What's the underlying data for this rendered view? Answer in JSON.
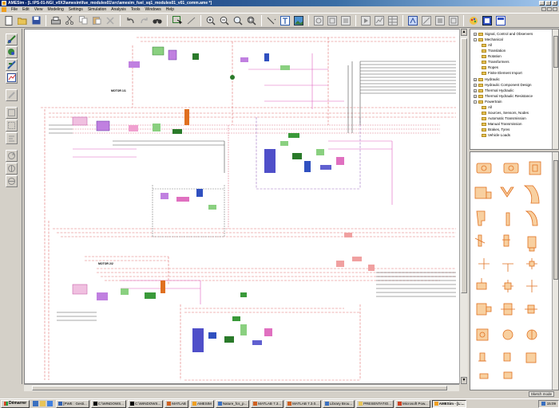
{
  "window": {
    "title": "AMESim - [L:\\PS-01-NGI_v0X3\\amesim\\fue_modules01\\src\\amesim_fuel_sq1_modules01_v01_comm.ame *]"
  },
  "menu": {
    "items": [
      "File",
      "Edit",
      "View",
      "Modeling",
      "Settings",
      "Simulation",
      "Analysis",
      "Tools",
      "Windows",
      "Help"
    ]
  },
  "toolbar": {
    "icons": [
      "new-icon",
      "open-icon",
      "save-icon",
      "print-icon",
      "cut-icon",
      "copy-icon",
      "paste-icon",
      "delete-icon",
      "undo-icon",
      "redo-icon",
      "find-icon",
      "select-icon",
      "zoom-in-icon",
      "zoom-out-icon",
      "zoom-fit-icon",
      "zoom-area-icon",
      "line-icon",
      "text-icon",
      "image-icon",
      "sketch-mode-icon",
      "submodel-mode-icon",
      "parameter-mode-icon",
      "simulation-mode-icon",
      "plot-icon",
      "table-icon",
      "replay-icon",
      "linear-icon",
      "batch-icon",
      "help-icon"
    ]
  },
  "canvas": {
    "labels": {
      "motor1": "MOTOR 1/1",
      "motor2": "MOTOR 2/2"
    }
  },
  "library": {
    "tree": [
      {
        "label": "Signal, Control and Observers",
        "level": 0,
        "expanded": false
      },
      {
        "label": "Mechanical",
        "level": 0,
        "expanded": true
      },
      {
        "label": "All",
        "level": 1
      },
      {
        "label": "Translation",
        "level": 1
      },
      {
        "label": "Rotation",
        "level": 1
      },
      {
        "label": "Transformers",
        "level": 1
      },
      {
        "label": "Ropes",
        "level": 1
      },
      {
        "label": "Finite Element Import",
        "level": 1
      },
      {
        "label": "Hydraulic",
        "level": 0,
        "expanded": false
      },
      {
        "label": "Hydraulic Component Design",
        "level": 0,
        "expanded": false
      },
      {
        "label": "Thermal Hydraulic",
        "level": 0,
        "expanded": false
      },
      {
        "label": "Thermal Hydraulic Resistance",
        "level": 0,
        "expanded": false
      },
      {
        "label": "Powertrain",
        "level": 0,
        "expanded": true
      },
      {
        "label": "All",
        "level": 1
      },
      {
        "label": "Sources, Sensors, Nodes",
        "level": 1
      },
      {
        "label": "Automatic Transmission",
        "level": 1
      },
      {
        "label": "Manual Transmission",
        "level": 1
      },
      {
        "label": "Brakes, Tyres",
        "level": 1
      },
      {
        "label": "Vehicle Loads",
        "level": 1
      }
    ]
  },
  "status": {
    "mode_button": "Sketch mode"
  },
  "taskbar": {
    "start_label": "Démarrer",
    "tasks": [
      {
        "label": "[PWE : Gesti...",
        "active": false
      },
      {
        "label": "C:\\WINDOWS...",
        "active": false
      },
      {
        "label": "C:\\WINDOWS...",
        "active": false
      },
      {
        "label": "MATLAB",
        "active": false
      },
      {
        "label": "AMESIM",
        "active": false
      },
      {
        "label": "Nature_fcs_p...",
        "active": false
      },
      {
        "label": "MATLAB 7.3...",
        "active": false
      },
      {
        "label": "MATLAB 7.3.0...",
        "active": false
      },
      {
        "label": "Library Brou...",
        "active": false
      },
      {
        "label": "PRESENTATIO...",
        "active": false
      },
      {
        "label": "Microsoft Pow...",
        "active": false
      },
      {
        "label": "AMESim - [L:...",
        "active": true
      }
    ],
    "clock": "15:09"
  },
  "colors": {
    "title_bar": "#0a246a",
    "diagram_red": "#d04848",
    "diagram_pink": "#e060c0",
    "diagram_blue": "#3030c0",
    "diagram_green": "#30a040",
    "component_orange": "#e07020"
  }
}
